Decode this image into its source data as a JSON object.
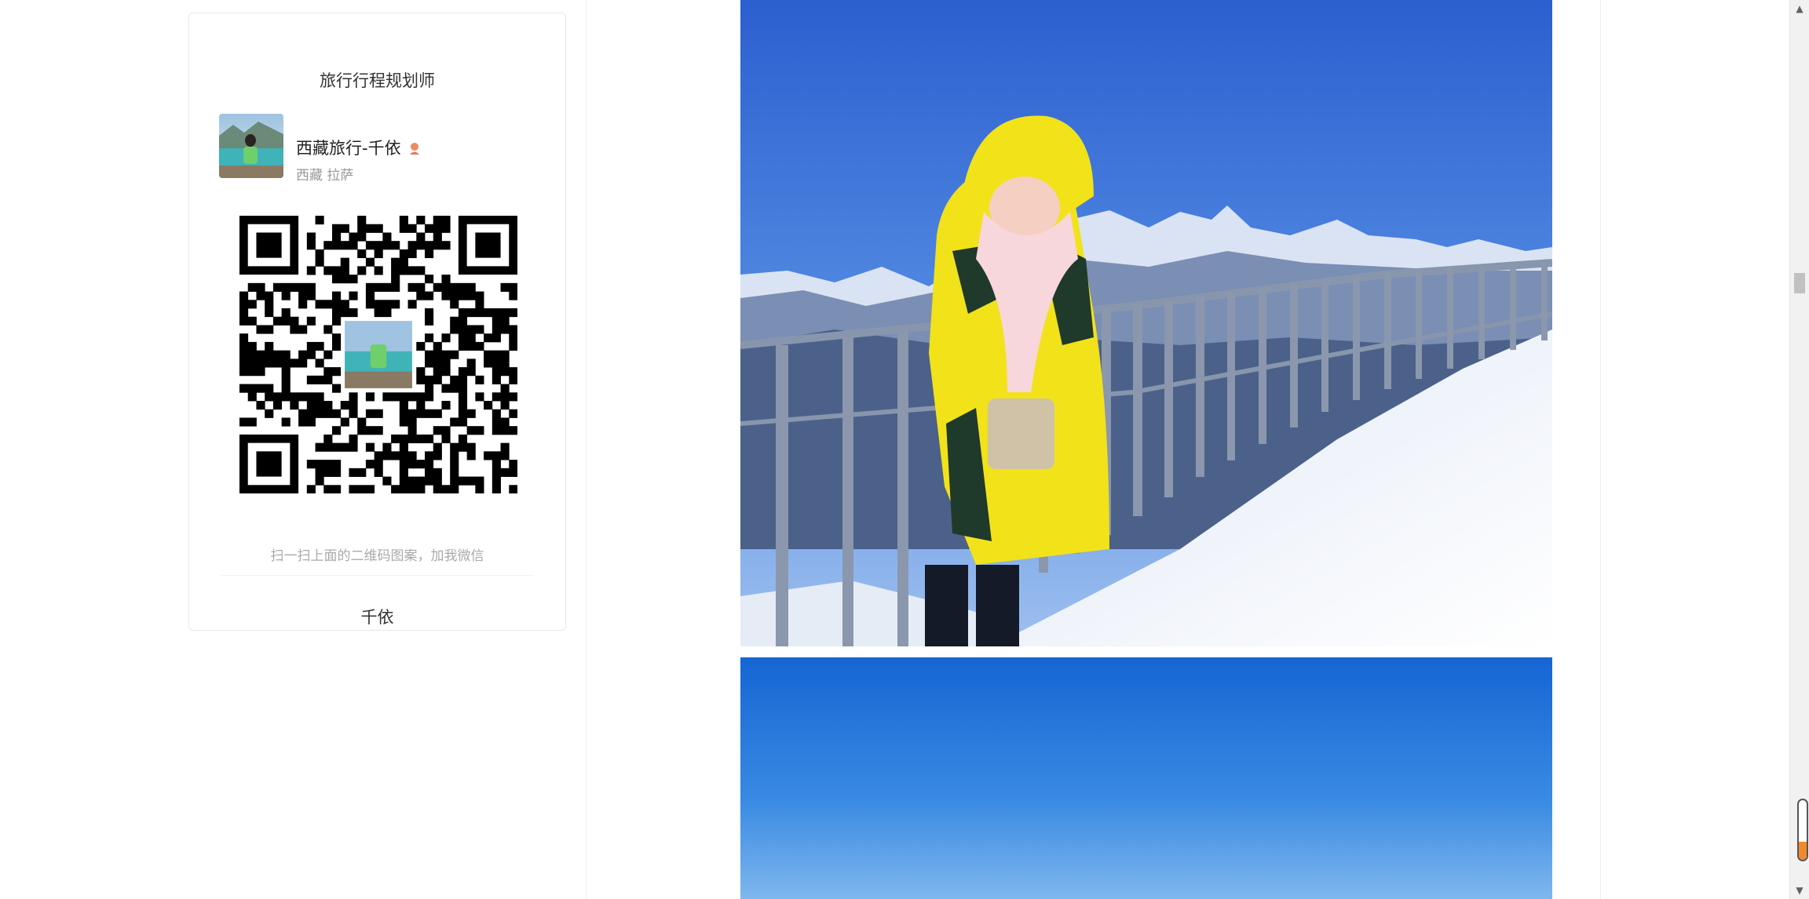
{
  "card": {
    "title": "旅行行程规划师",
    "profile": {
      "name": "西藏旅行-千依",
      "location": "西藏 拉萨"
    },
    "qr_hint": "扫一扫上面的二维码图案，加我微信",
    "wechat_name": "千依"
  },
  "scrollbar": {
    "up_arrow": "▲",
    "down_arrow": "▼",
    "position_fraction": 0.3
  },
  "colors": {
    "sky_blue": "#3f72d6",
    "jacket_yellow": "#f2e21a",
    "snow": "#f4f6fb",
    "badge_orange": "#f08a2c"
  }
}
